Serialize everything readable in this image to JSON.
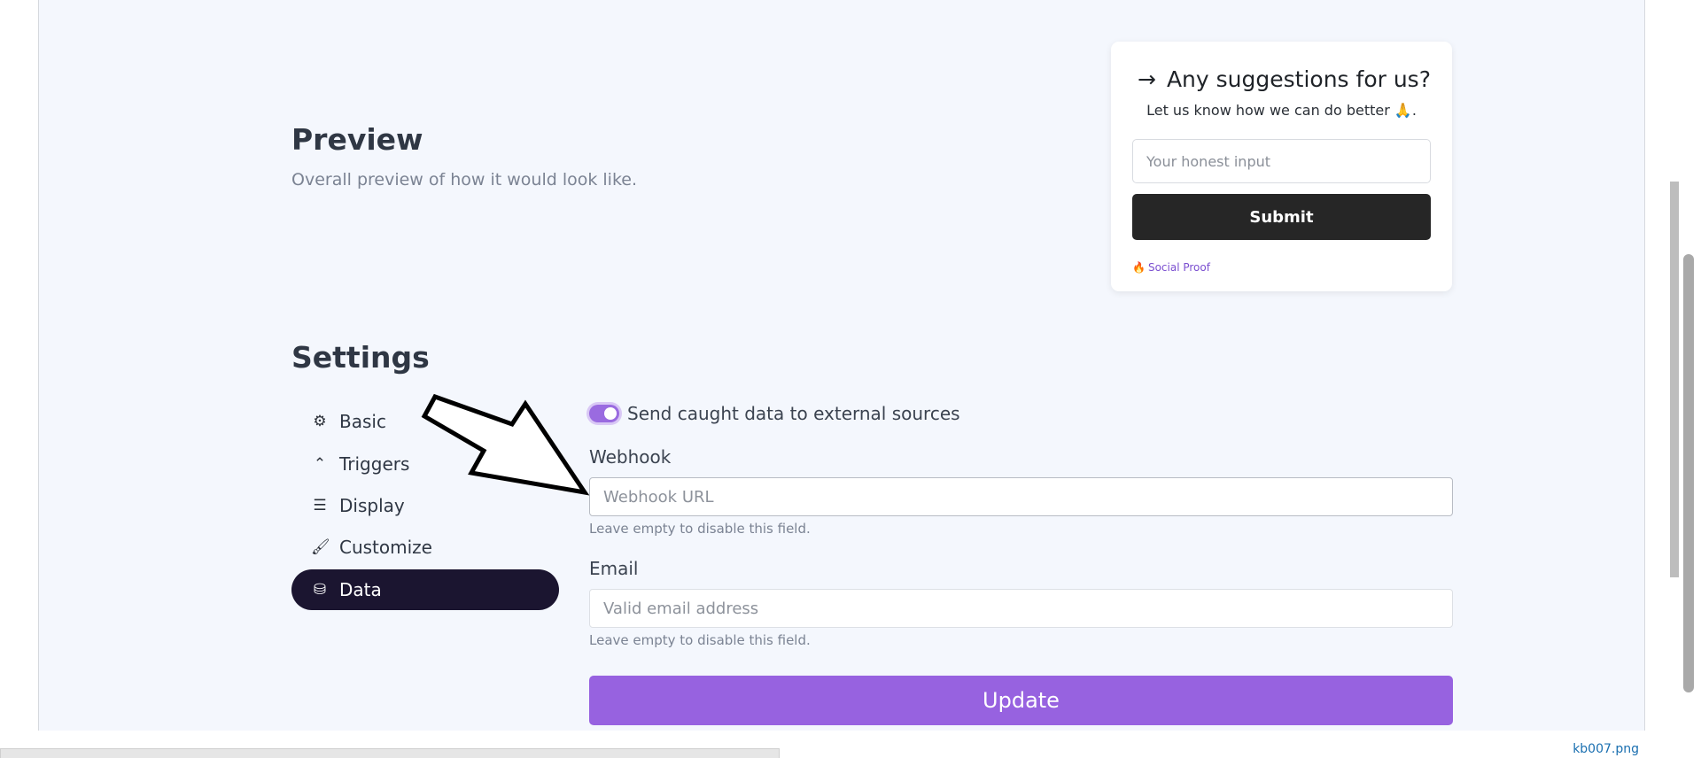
{
  "preview": {
    "title": "Preview",
    "subtitle": "Overall preview of how it would look like."
  },
  "widget": {
    "arrow": "→",
    "heading": "Any suggestions for us?",
    "subheading": "Let us know how we can do better 🙏.",
    "input_placeholder": "Your honest input",
    "submit_label": "Submit",
    "footer_icon": "🔥",
    "footer_label": "Social Proof"
  },
  "settings": {
    "title": "Settings",
    "nav": [
      {
        "label": "Basic",
        "icon": "gear-icon",
        "glyph": "⚙"
      },
      {
        "label": "Triggers",
        "icon": "chevron-up-icon",
        "glyph": "⌃"
      },
      {
        "label": "Display",
        "icon": "sliders-icon",
        "glyph": "☰"
      },
      {
        "label": "Customize",
        "icon": "brush-icon",
        "glyph": "🖌"
      },
      {
        "label": "Data",
        "icon": "database-icon",
        "glyph": "⛁",
        "active": true
      }
    ]
  },
  "form": {
    "toggle_label": "Send caught data to external sources",
    "toggle_on": true,
    "webhook_label": "Webhook",
    "webhook_placeholder": "Webhook URL",
    "webhook_value": "",
    "webhook_help": "Leave empty to disable this field.",
    "email_label": "Email",
    "email_placeholder": "Valid email address",
    "email_value": "",
    "email_help": "Leave empty to disable this field.",
    "update_label": "Update"
  },
  "colors": {
    "accent": "#9762e0",
    "active_nav": "#1b1530",
    "submit": "#262626",
    "background": "#f4f7fd"
  },
  "filename": "kb007.png"
}
